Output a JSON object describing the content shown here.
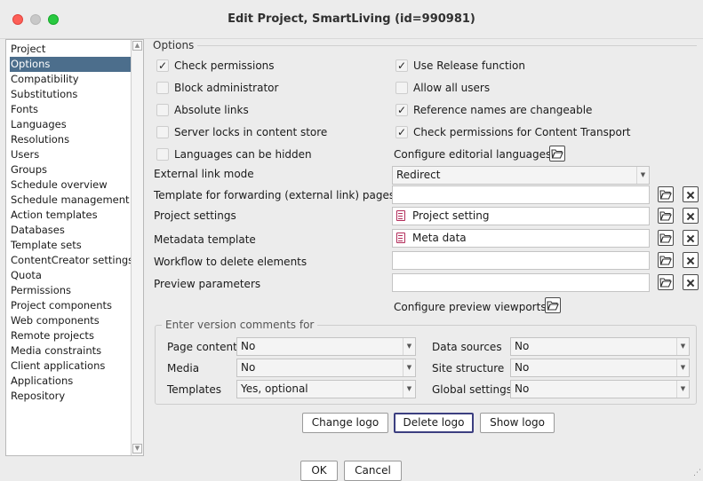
{
  "window": {
    "title": "Edit Project, SmartLiving (id=990981)"
  },
  "sidebar": {
    "items": [
      {
        "label": "Project",
        "selected": false
      },
      {
        "label": "Options",
        "selected": true
      },
      {
        "label": "Compatibility",
        "selected": false
      },
      {
        "label": "Substitutions",
        "selected": false
      },
      {
        "label": "Fonts",
        "selected": false
      },
      {
        "label": "Languages",
        "selected": false
      },
      {
        "label": "Resolutions",
        "selected": false
      },
      {
        "label": "Users",
        "selected": false
      },
      {
        "label": "Groups",
        "selected": false
      },
      {
        "label": "Schedule overview",
        "selected": false
      },
      {
        "label": "Schedule management",
        "selected": false
      },
      {
        "label": "Action templates",
        "selected": false
      },
      {
        "label": "Databases",
        "selected": false
      },
      {
        "label": "Template sets",
        "selected": false
      },
      {
        "label": "ContentCreator settings",
        "selected": false
      },
      {
        "label": "Quota",
        "selected": false
      },
      {
        "label": "Permissions",
        "selected": false
      },
      {
        "label": "Project components",
        "selected": false
      },
      {
        "label": "Web components",
        "selected": false
      },
      {
        "label": "Remote projects",
        "selected": false
      },
      {
        "label": "Media constraints",
        "selected": false
      },
      {
        "label": "Client applications",
        "selected": false
      },
      {
        "label": "Applications",
        "selected": false
      },
      {
        "label": "Repository",
        "selected": false
      }
    ]
  },
  "options": {
    "legend": "Options",
    "checkboxes_left": [
      {
        "label": "Check permissions",
        "checked": true
      },
      {
        "label": "Block administrator",
        "checked": false
      },
      {
        "label": "Absolute links",
        "checked": false
      },
      {
        "label": "Server locks in content store",
        "checked": false
      },
      {
        "label": "Languages can be hidden",
        "checked": false
      }
    ],
    "checkboxes_right": [
      {
        "label": "Use Release function",
        "checked": true
      },
      {
        "label": "Allow all users",
        "checked": false
      },
      {
        "label": "Reference names are changeable",
        "checked": true
      },
      {
        "label": "Check permissions for Content Transport",
        "checked": true
      }
    ],
    "configure_editorial_languages": "Configure editorial languages",
    "external_link_mode": {
      "label": "External link mode",
      "value": "Redirect"
    },
    "template_forwarding": {
      "label": "Template for forwarding (external link) pages",
      "value": ""
    },
    "project_settings": {
      "label": "Project settings",
      "value": "Project setting"
    },
    "metadata_template": {
      "label": "Metadata template",
      "value": "Meta data"
    },
    "workflow_delete": {
      "label": "Workflow to delete elements",
      "value": ""
    },
    "preview_parameters": {
      "label": "Preview parameters",
      "value": ""
    },
    "configure_preview_viewports": "Configure preview viewports",
    "check_mark": "✓"
  },
  "version_comments": {
    "legend": "Enter version comments for",
    "left": [
      {
        "label": "Page content",
        "value": "No"
      },
      {
        "label": "Media",
        "value": "No"
      },
      {
        "label": "Templates",
        "value": "Yes, optional"
      }
    ],
    "right": [
      {
        "label": "Data sources",
        "value": "No"
      },
      {
        "label": "Site structure",
        "value": "No"
      },
      {
        "label": "Global settings",
        "value": "No"
      }
    ]
  },
  "logo_buttons": {
    "change": "Change logo",
    "delete": "Delete logo",
    "show": "Show logo"
  },
  "dialog_buttons": {
    "ok": "OK",
    "cancel": "Cancel"
  },
  "icons": {
    "dropdown_arrow": "▼",
    "scroll_up": "▲",
    "scroll_down": "▼"
  }
}
